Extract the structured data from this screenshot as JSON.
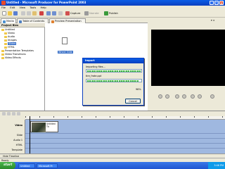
{
  "window": {
    "title": "Untitled - Microsoft Producer for PowerPoint 2003"
  },
  "menu": [
    "File",
    "Edit",
    "View",
    "Tools",
    "Help"
  ],
  "toolbar": {
    "capture_label": "Capture",
    "narrate_label": "Narrate",
    "publish_label": "Publish"
  },
  "tabs": [
    {
      "label": "Media"
    },
    {
      "label": "Table of Contents"
    },
    {
      "label": "Preview Presentation"
    }
  ],
  "project_files": {
    "header": "Project files",
    "items": [
      "Untitled",
      "Video",
      "Audio",
      "Images",
      "Slides",
      "HTML",
      "Presentation Templates",
      "Video Transitions",
      "Video Effects"
    ]
  },
  "content": {
    "file_label": "Wheel Slide"
  },
  "dialog": {
    "title": "Import",
    "importing_label": "Importing files...",
    "file_name": "tire_frate.ppt",
    "percent": "96%",
    "cancel_label": "Cancel",
    "progress_top": 1.0,
    "progress_bottom": 0.96
  },
  "timeline": {
    "tracks": [
      "Video",
      "Slide",
      "Audio 1",
      "HTML",
      "Template"
    ],
    "clip_name": "Untitled Th",
    "tab_label": "Hide Timeline"
  },
  "status": {
    "text": "Ready"
  },
  "taskbar": {
    "start_label": "start",
    "items": [
      "Untitled",
      "Microsoft Pr"
    ],
    "clock": "3:46 PM"
  },
  "colors": {
    "titlebar": "#0b3fbf",
    "track": "#9fb8e0",
    "progress": "#3db83d"
  }
}
